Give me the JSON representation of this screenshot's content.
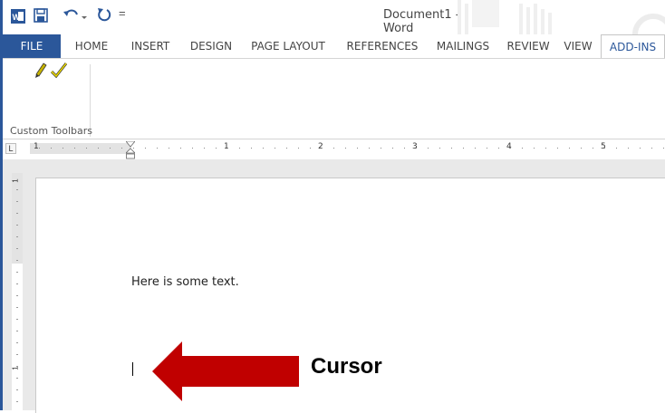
{
  "window": {
    "title": "Document1 - Word"
  },
  "quick_access": {
    "customize_glyph": "="
  },
  "tabs": [
    {
      "label": "FILE"
    },
    {
      "label": "HOME"
    },
    {
      "label": "INSERT"
    },
    {
      "label": "DESIGN"
    },
    {
      "label": "PAGE LAYOUT"
    },
    {
      "label": "REFERENCES"
    },
    {
      "label": "MAILINGS"
    },
    {
      "label": "REVIEW"
    },
    {
      "label": "VIEW"
    },
    {
      "label": "ADD-INS"
    }
  ],
  "active_tab": "ADD-INS",
  "ribbon": {
    "group_label": "Custom Toolbars",
    "buttons": [
      {
        "icon": "pencil-icon"
      },
      {
        "icon": "checkmark-icon"
      }
    ]
  },
  "ruler": {
    "tab_selector": "L",
    "horizontal_numbers": [
      "1",
      "1",
      "2",
      "3",
      "4",
      "5"
    ],
    "vertical_numbers": [
      "1",
      "1"
    ]
  },
  "document": {
    "body_text": "Here is some text."
  },
  "annotation": {
    "label": "Cursor",
    "arrow_color": "#c00000"
  },
  "colors": {
    "accent": "#2b579a",
    "annotation": "#c00000"
  }
}
